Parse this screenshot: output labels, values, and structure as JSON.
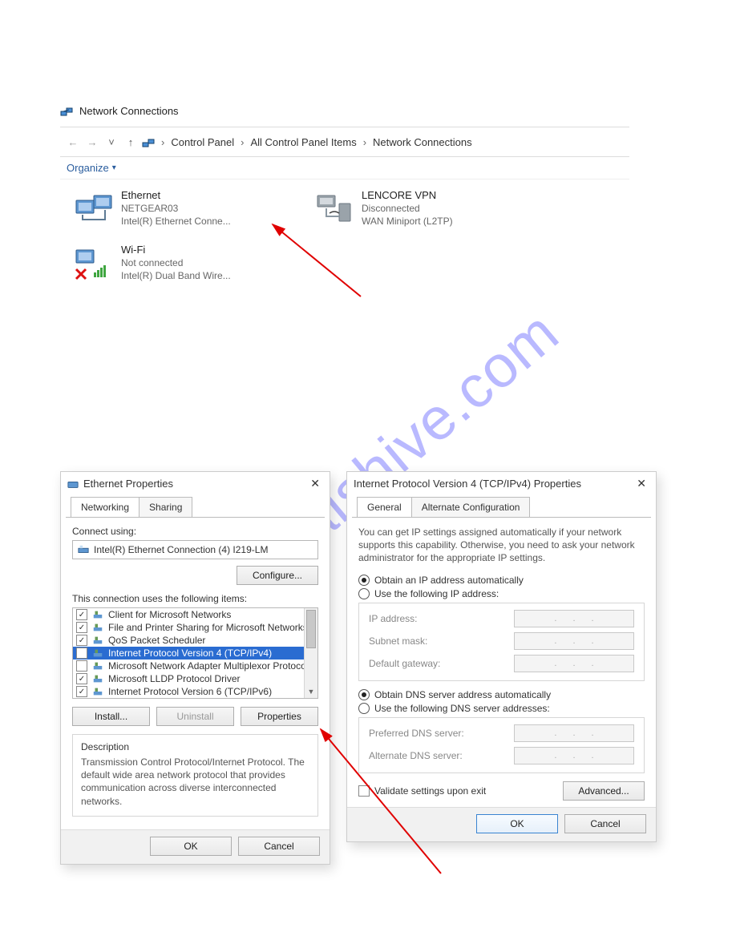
{
  "watermark": "manualshive.com",
  "explorer": {
    "title": "Network Connections",
    "breadcrumbs": [
      "Control Panel",
      "All Control Panel Items",
      "Network Connections"
    ],
    "toolbar": {
      "organize": "Organize"
    },
    "items": [
      {
        "name": "Ethernet",
        "line2": "NETGEAR03",
        "line3": "Intel(R) Ethernet Conne..."
      },
      {
        "name": "LENCORE VPN",
        "line2": "Disconnected",
        "line3": "WAN Miniport (L2TP)"
      },
      {
        "name": "Wi-Fi",
        "line2": "Not connected",
        "line3": "Intel(R) Dual Band Wire..."
      }
    ]
  },
  "ethprops": {
    "title": "Ethernet Properties",
    "tabs": [
      "Networking",
      "Sharing"
    ],
    "connect_using_label": "Connect using:",
    "adapter": "Intel(R) Ethernet Connection (4) I219-LM",
    "configure": "Configure...",
    "items_label": "This connection uses the following items:",
    "items": [
      {
        "checked": true,
        "label": "Client for Microsoft Networks"
      },
      {
        "checked": true,
        "label": "File and Printer Sharing for Microsoft Networks"
      },
      {
        "checked": true,
        "label": "QoS Packet Scheduler"
      },
      {
        "checked": true,
        "label": "Internet Protocol Version 4 (TCP/IPv4)",
        "selected": true
      },
      {
        "checked": false,
        "label": "Microsoft Network Adapter Multiplexor Protocol"
      },
      {
        "checked": true,
        "label": "Microsoft LLDP Protocol Driver"
      },
      {
        "checked": true,
        "label": "Internet Protocol Version 6 (TCP/IPv6)"
      }
    ],
    "buttons": {
      "install": "Install...",
      "uninstall": "Uninstall",
      "properties": "Properties"
    },
    "description_title": "Description",
    "description": "Transmission Control Protocol/Internet Protocol. The default wide area network protocol that provides communication across diverse interconnected networks.",
    "ok": "OK",
    "cancel": "Cancel"
  },
  "ipv4": {
    "title": "Internet Protocol Version 4 (TCP/IPv4) Properties",
    "tabs": [
      "General",
      "Alternate Configuration"
    ],
    "intro": "You can get IP settings assigned automatically if your network supports this capability. Otherwise, you need to ask your network administrator for the appropriate IP settings.",
    "obtain_ip": "Obtain an IP address automatically",
    "use_ip": "Use the following IP address:",
    "ip_label": "IP address:",
    "mask_label": "Subnet mask:",
    "gw_label": "Default gateway:",
    "obtain_dns": "Obtain DNS server address automatically",
    "use_dns": "Use the following DNS server addresses:",
    "pref_dns_label": "Preferred DNS server:",
    "alt_dns_label": "Alternate DNS server:",
    "validate": "Validate settings upon exit",
    "advanced": "Advanced...",
    "ok": "OK",
    "cancel": "Cancel"
  }
}
